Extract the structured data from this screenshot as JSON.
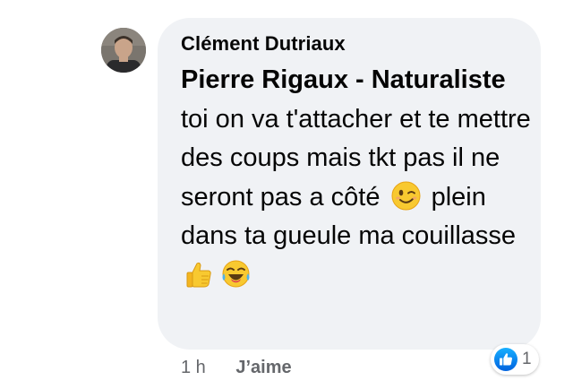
{
  "comment": {
    "author": "Clément Dutriaux",
    "mention": "Pierre Rigaux - Naturaliste",
    "text_part1": " toi on va t'attacher et te mettre des coups mais tkt pas il ne seront pas a côté ",
    "emoji_1": "winking-face-emoji",
    "text_part2": " plein dans ta gueule ma couillasse ",
    "emoji_2": "thumbs-up-emoji",
    "emoji_3": "tears-of-joy-emoji",
    "time": "1 h",
    "like_label": "J’aime",
    "reaction_icon": "like-reaction-icon",
    "reaction_count": "1"
  },
  "colors": {
    "bubble": "#f0f2f5",
    "meta_text": "#65676b",
    "like_blue": "#1877f2"
  }
}
